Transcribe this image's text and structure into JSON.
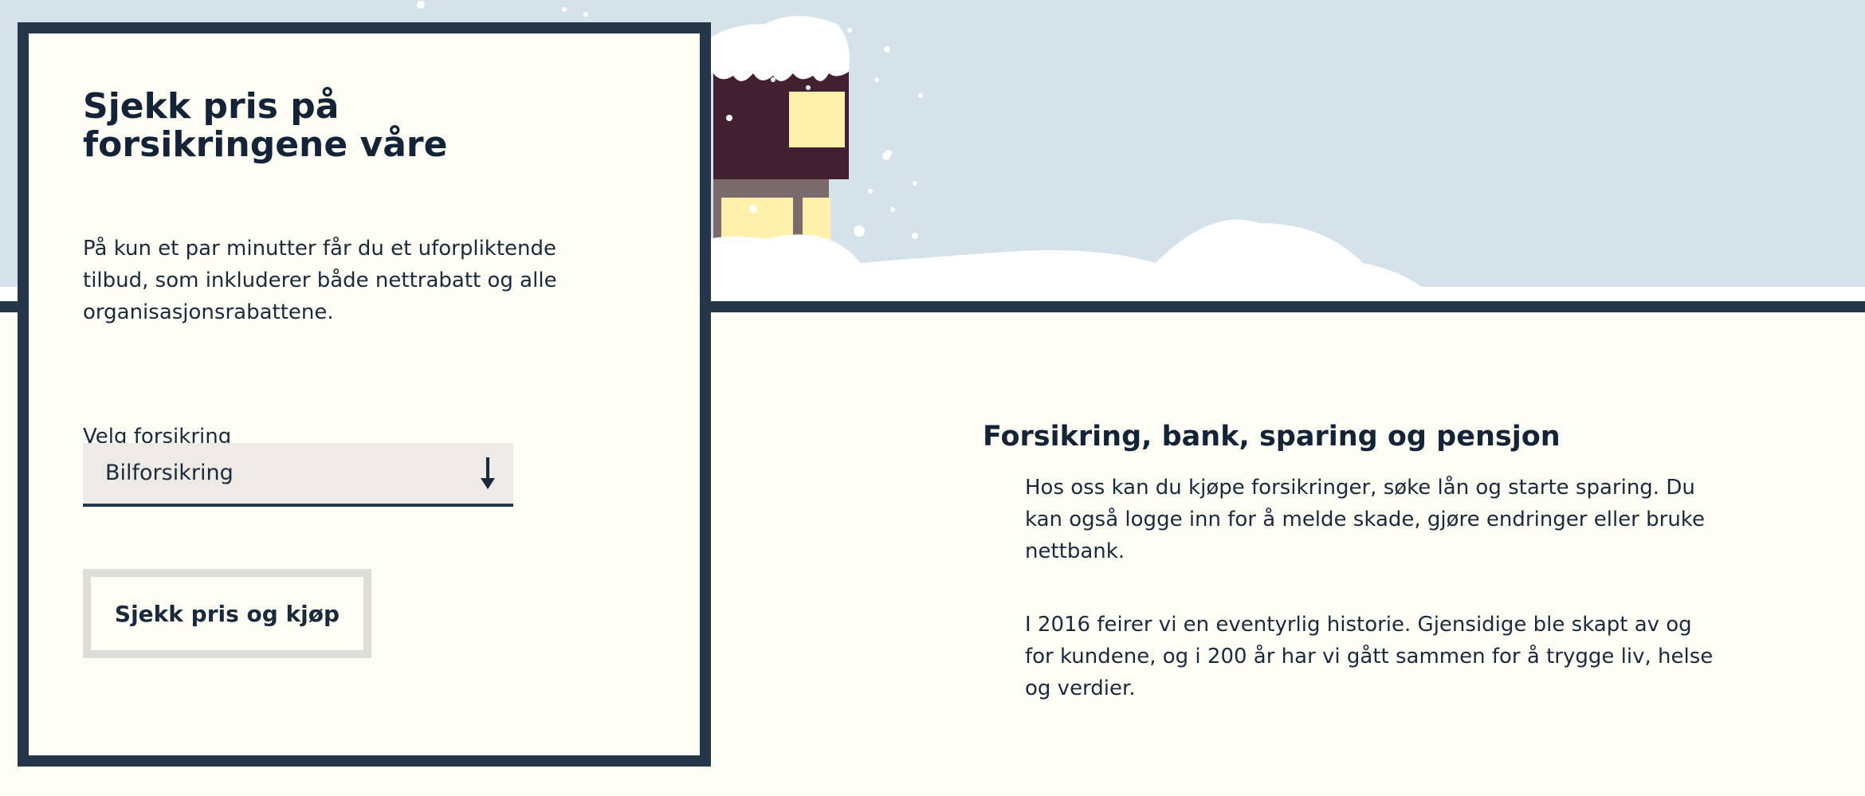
{
  "card": {
    "title": "Sjekk pris på forsikringene våre",
    "description": "På kun et par minutter får du et uforpliktende tilbud, som inkluderer både nettrabatt og alle organisasjonsrabattene.",
    "select_label": "Velg forsikring",
    "select_value": "Bilforsikring",
    "button_label": "Sjekk pris og kjøp"
  },
  "info": {
    "title": "Forsikring, bank, sparing og pensjon",
    "paragraph1": "Hos oss kan du kjøpe forsikringer, søke lån og starte sparing. Du kan også logge inn for å melde skade, gjøre endringer eller bruke nettbank.",
    "paragraph2": "I 2016 feirer vi en eventyrlig historie. Gjensidige ble skapt av og for kundene, og i 200 år har vi gått sammen for å trygge liv, helse og verdier."
  },
  "icons": {
    "select_arrow": "arrow-down-icon"
  },
  "colors": {
    "navy": "#253648",
    "sky": "#d5e2ea",
    "cream": "#fefef6",
    "house": "#432030",
    "window": "#fdf1ab"
  }
}
